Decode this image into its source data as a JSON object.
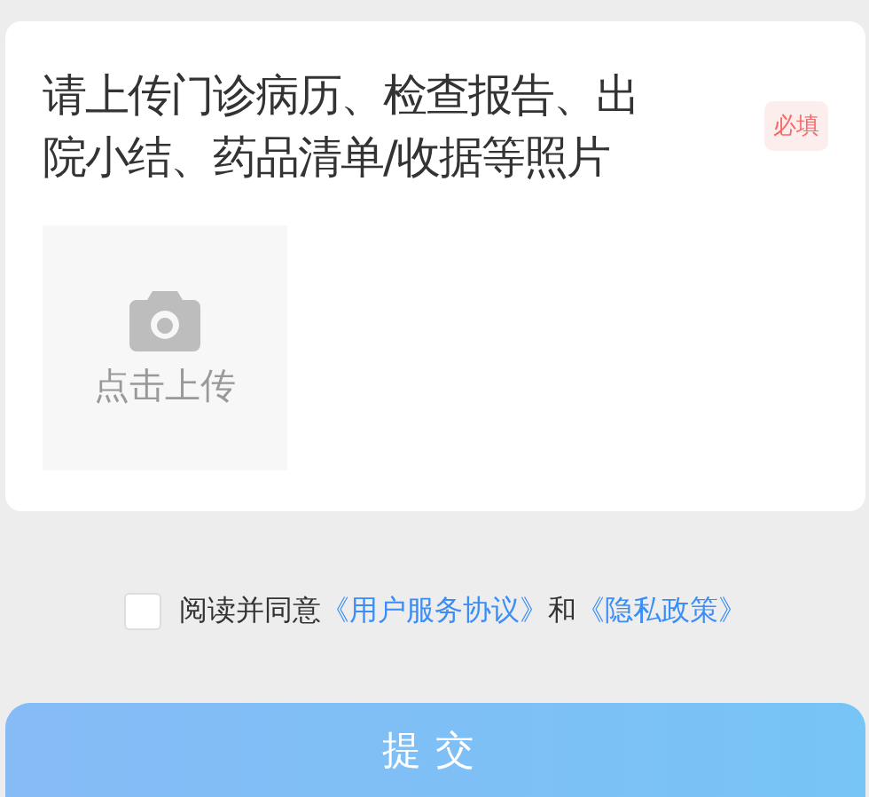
{
  "upload_card": {
    "title": "请上传门诊病历、检查报告、出院小结、药品清单/收据等照片",
    "required_badge": "必填",
    "upload_tile": {
      "label": "点击上传"
    }
  },
  "agreement": {
    "checked": false,
    "text_before": "阅读并同意",
    "link_terms": "《用户服务协议》",
    "text_and": "和",
    "link_privacy": "《隐私政策》"
  },
  "submit_button": {
    "label": "提交"
  }
}
